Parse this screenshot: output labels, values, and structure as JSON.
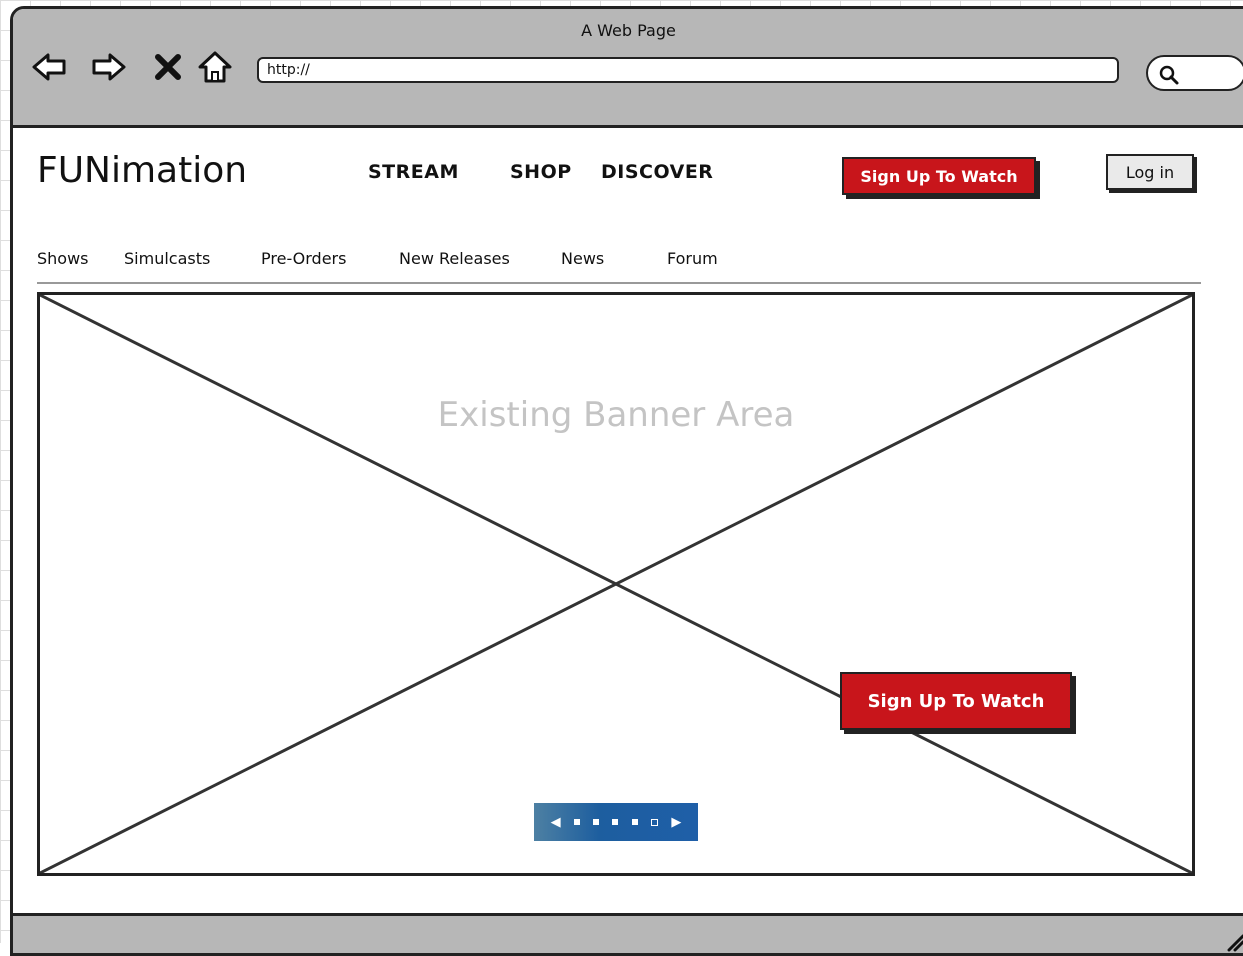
{
  "window": {
    "title": "A Web Page"
  },
  "browser": {
    "address_value": "http://"
  },
  "header": {
    "logo": "FUNimation",
    "nav": [
      "STREAM",
      "SHOP",
      "DISCOVER"
    ],
    "signup_label": "Sign Up To Watch",
    "login_label": "Log in"
  },
  "subnav": [
    "Shows",
    "Simulcasts",
    "Pre-Orders",
    "New Releases",
    "News",
    "Forum"
  ],
  "banner": {
    "label": "Existing Banner Area",
    "cta_label": "Sign Up To Watch",
    "carousel": {
      "prev_icon": "triangle-left-icon",
      "next_icon": "triangle-right-icon",
      "page_count": 5,
      "active_page": 4
    }
  },
  "colors": {
    "accent_red": "#c8151b",
    "chrome_gray": "#b7b7b7",
    "carousel_blue": "#1d5e9f",
    "banner_label_gray": "#c4c4c4"
  },
  "icons": {
    "back": "back-arrow-icon",
    "forward": "forward-arrow-icon",
    "stop": "stop-x-icon",
    "home": "home-icon",
    "search": "search-icon",
    "resize": "resize-grip-icon"
  }
}
